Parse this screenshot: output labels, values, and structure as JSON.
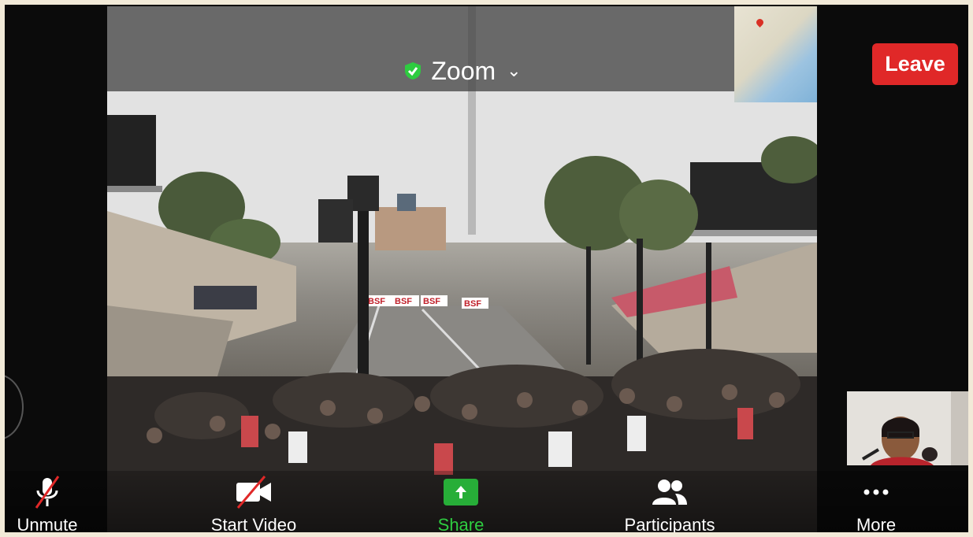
{
  "meeting": {
    "title": "Zoom",
    "leave_label": "Leave"
  },
  "toolbar": {
    "unmute_label": "Unmute",
    "start_video_label": "Start Video",
    "share_label": "Share",
    "participants_label": "Participants",
    "more_label": "More"
  },
  "scene": {
    "banner_texts": [
      "BSF",
      "BSF",
      "BSF",
      "BSF"
    ]
  },
  "colors": {
    "leave": "#e02828",
    "share": "#27ae38",
    "shield": "#2ecc40"
  }
}
